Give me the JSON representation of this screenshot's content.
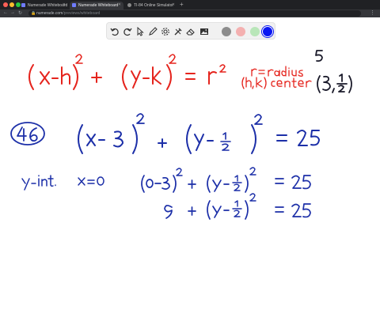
{
  "browser": {
    "tabs": [
      {
        "label": "Numerade Whiteboard",
        "active": false
      },
      {
        "label": "Numerade Whiteboard",
        "active": true
      },
      {
        "label": "TI-84 Online Simulator",
        "active": false
      }
    ],
    "url": {
      "host": "numerade.com",
      "path": "/previews/whiteboard"
    }
  },
  "toolbar": {
    "tools": [
      "undo-icon",
      "redo-icon",
      "select-icon",
      "pen-icon",
      "settings-icon",
      "tools-icon",
      "eraser-icon",
      "image-icon"
    ],
    "colors": [
      "#8c8c8c",
      "#f4b0b0",
      "#b9e6b9",
      "#0a17f2"
    ],
    "active_color": "#0a17f2"
  },
  "whiteboard": {
    "ink_colors": {
      "red": "#e5241d",
      "blue": "#1c2fa8",
      "black": "#1a1a2a"
    },
    "formula": {
      "text": "(x-h)^2 + (y-k)^2 = r^2"
    },
    "notes": {
      "radius": "r = radius",
      "center": "(h,k) center",
      "radius_value": "5",
      "center_value": "(3, 1/2)"
    },
    "problem": {
      "number": "46",
      "equation": "(x - 3)^2 + (y - 1/2)^2 = 25"
    },
    "work": {
      "label": "y-int.",
      "condition": "x = 0",
      "step1": "(0-3)^2 + (y - 1/2)^2 = 25",
      "step2": "9 + (y - 1/2)^2 = 25"
    }
  }
}
